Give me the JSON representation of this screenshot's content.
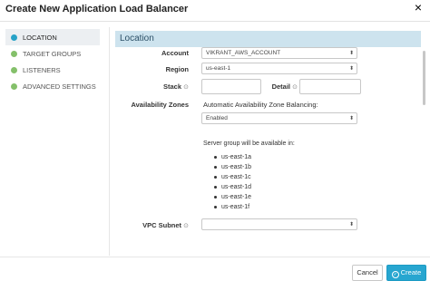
{
  "dialog": {
    "title": "Create New Application Load Balancer",
    "close_icon": "×"
  },
  "sidebar": {
    "items": [
      {
        "label": "LOCATION",
        "active": true
      },
      {
        "label": "TARGET GROUPS",
        "active": false
      },
      {
        "label": "LISTENERS",
        "active": false
      },
      {
        "label": "ADVANCED SETTINGS",
        "active": false
      }
    ]
  },
  "section": {
    "title": "Location"
  },
  "form": {
    "account": {
      "label": "Account",
      "value": "VIKRANT_AWS_ACCOUNT"
    },
    "region": {
      "label": "Region",
      "value": "us-east-1"
    },
    "stack": {
      "label": "Stack",
      "value": ""
    },
    "detail": {
      "label": "Detail",
      "value": ""
    },
    "availability_zones": {
      "label": "Availability Zones",
      "balancing_label": "Automatic Availability Zone Balancing:",
      "balancing_value": "Enabled",
      "server_group_note": "Server group will be available in:",
      "zones": [
        "us-east-1a",
        "us-east-1b",
        "us-east-1c",
        "us-east-1d",
        "us-east-1e",
        "us-east-1f"
      ]
    },
    "vpc_subnet": {
      "label": "VPC Subnet",
      "value": ""
    }
  },
  "footer": {
    "cancel_label": "Cancel",
    "create_label": "Create"
  },
  "colors": {
    "accent": "#27a6d0",
    "section_header_bg": "#cde3ee",
    "active_dot": "#27a2c7",
    "complete_dot": "#84c06a"
  }
}
